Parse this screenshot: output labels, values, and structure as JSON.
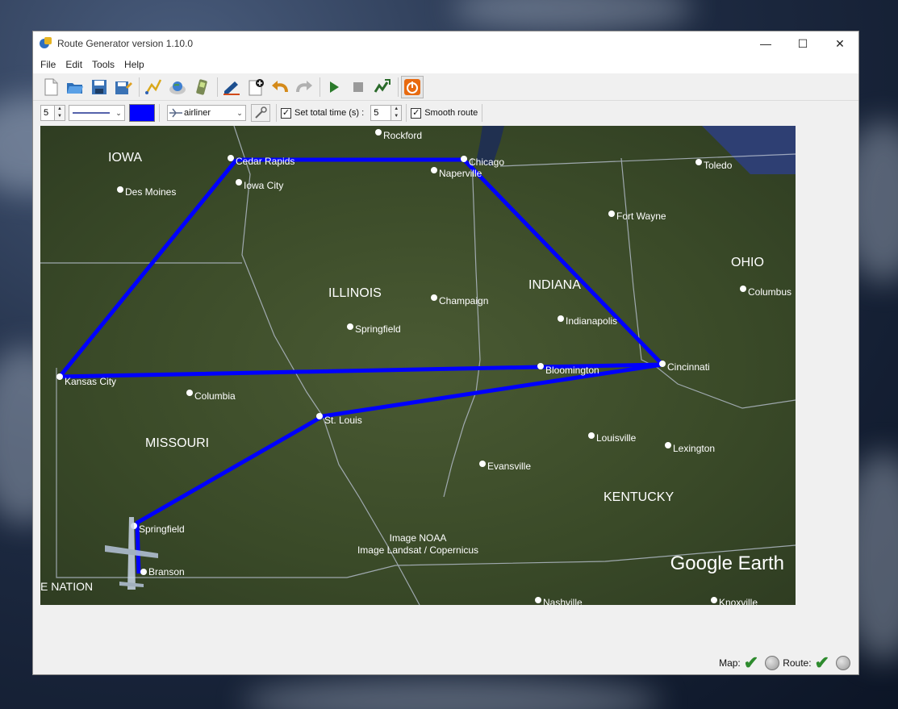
{
  "window": {
    "title": "Route Generator version 1.10.0"
  },
  "menu": [
    "File",
    "Edit",
    "Tools",
    "Help"
  ],
  "toolbar2": {
    "line_width": "5",
    "model": "airliner",
    "set_total_time_label": "Set total time (s) :",
    "total_time": "5",
    "smooth_route_label": "Smooth route",
    "route_color": "#0000ff"
  },
  "map": {
    "states": [
      "IOWA",
      "ILLINOIS",
      "INDIANA",
      "OHIO",
      "MISSOURI",
      "KENTUCKY",
      "E NATION"
    ],
    "cities": [
      "Rockford",
      "Cedar Rapids",
      "Chicago",
      "Naperville",
      "Toledo",
      "Des Moines",
      "Iowa City",
      "Fort Wayne",
      "Columbus",
      "Champaign",
      "Indianapolis",
      "Springfield",
      "Bloomington",
      "Cincinnati",
      "Kansas City",
      "Columbia",
      "St. Louis",
      "Louisville",
      "Lexington",
      "Evansville",
      "Springfield",
      "Branson",
      "Nashville",
      "Knoxville"
    ],
    "credits": [
      "Image NOAA",
      "Image Landsat / Copernicus"
    ],
    "logo": "Google Earth"
  },
  "status": {
    "map_label": "Map:",
    "route_label": "Route:"
  }
}
